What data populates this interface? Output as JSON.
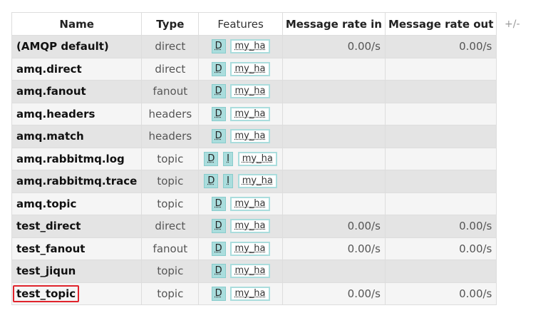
{
  "table": {
    "headers": {
      "name": "Name",
      "type": "Type",
      "features": "Features",
      "rate_in": "Message rate in",
      "rate_out": "Message rate out"
    },
    "column_toggle": "+/-",
    "rows": [
      {
        "name": "(AMQP default)",
        "type": "direct",
        "features": [
          "D"
        ],
        "policy": "my_ha",
        "rate_in": "0.00/s",
        "rate_out": "0.00/s",
        "highlighted": false
      },
      {
        "name": "amq.direct",
        "type": "direct",
        "features": [
          "D"
        ],
        "policy": "my_ha",
        "rate_in": "",
        "rate_out": "",
        "highlighted": false
      },
      {
        "name": "amq.fanout",
        "type": "fanout",
        "features": [
          "D"
        ],
        "policy": "my_ha",
        "rate_in": "",
        "rate_out": "",
        "highlighted": false
      },
      {
        "name": "amq.headers",
        "type": "headers",
        "features": [
          "D"
        ],
        "policy": "my_ha",
        "rate_in": "",
        "rate_out": "",
        "highlighted": false
      },
      {
        "name": "amq.match",
        "type": "headers",
        "features": [
          "D"
        ],
        "policy": "my_ha",
        "rate_in": "",
        "rate_out": "",
        "highlighted": false
      },
      {
        "name": "amq.rabbitmq.log",
        "type": "topic",
        "features": [
          "D",
          "I"
        ],
        "policy": "my_ha",
        "rate_in": "",
        "rate_out": "",
        "highlighted": false
      },
      {
        "name": "amq.rabbitmq.trace",
        "type": "topic",
        "features": [
          "D",
          "I"
        ],
        "policy": "my_ha",
        "rate_in": "",
        "rate_out": "",
        "highlighted": false
      },
      {
        "name": "amq.topic",
        "type": "topic",
        "features": [
          "D"
        ],
        "policy": "my_ha",
        "rate_in": "",
        "rate_out": "",
        "highlighted": false
      },
      {
        "name": "test_direct",
        "type": "direct",
        "features": [
          "D"
        ],
        "policy": "my_ha",
        "rate_in": "0.00/s",
        "rate_out": "0.00/s",
        "highlighted": false
      },
      {
        "name": "test_fanout",
        "type": "fanout",
        "features": [
          "D"
        ],
        "policy": "my_ha",
        "rate_in": "0.00/s",
        "rate_out": "0.00/s",
        "highlighted": false
      },
      {
        "name": "test_jiqun",
        "type": "topic",
        "features": [
          "D"
        ],
        "policy": "my_ha",
        "rate_in": "",
        "rate_out": "",
        "highlighted": false
      },
      {
        "name": "test_topic",
        "type": "topic",
        "features": [
          "D"
        ],
        "policy": "my_ha",
        "rate_in": "0.00/s",
        "rate_out": "0.00/s",
        "highlighted": true
      }
    ]
  },
  "colors": {
    "row_alt": "#e4e4e4",
    "row_plain": "#f5f5f5",
    "badge_fill": "#aadddd",
    "highlight_border": "#e0242c"
  }
}
